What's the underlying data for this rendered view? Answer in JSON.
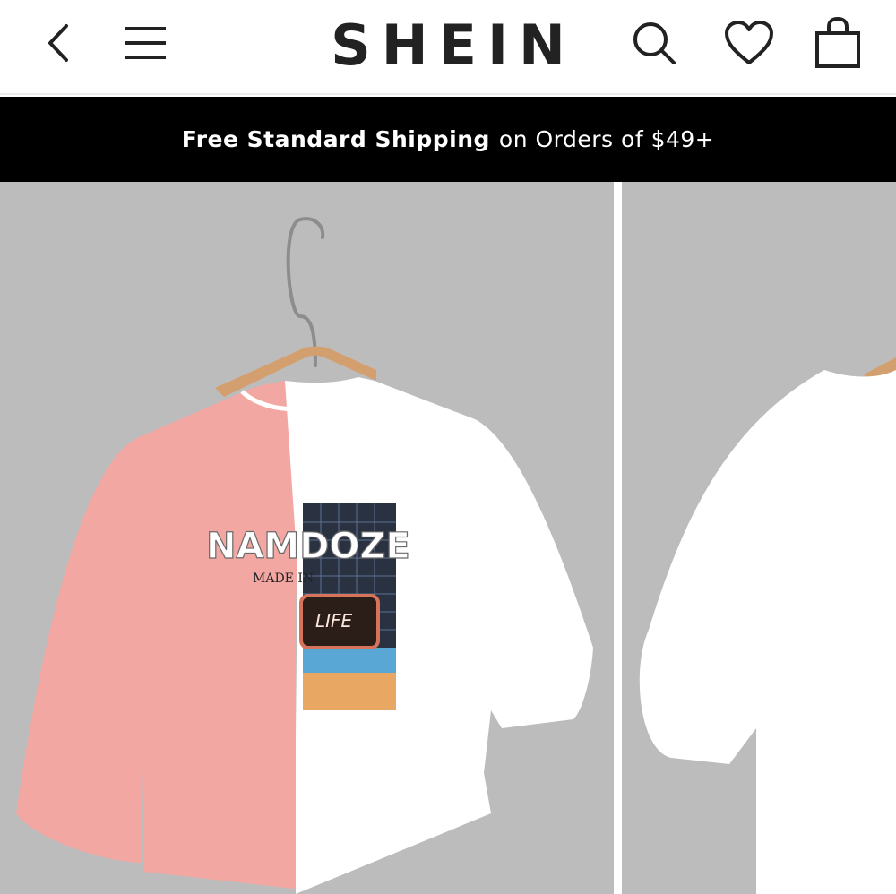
{
  "header": {
    "logo_text": "SHEIN",
    "icons": {
      "back": "chevron-left-icon",
      "menu": "hamburger-menu-icon",
      "search": "search-icon",
      "wishlist": "heart-icon",
      "bag": "shopping-bag-icon"
    }
  },
  "promo": {
    "bold_text": "Free Standard Shipping",
    "rest_text": "on Orders of $49+"
  },
  "gallery": {
    "images": [
      {
        "graphic_text_main": "NAMDOZE",
        "graphic_text_sub": "MADE IN",
        "graphic_text_sign": "LIFE"
      },
      {}
    ]
  },
  "colors": {
    "background_gray": "#bdbcbc",
    "pink": "#f2a7a3",
    "promo_bg": "#000000",
    "logo": "#222222"
  }
}
